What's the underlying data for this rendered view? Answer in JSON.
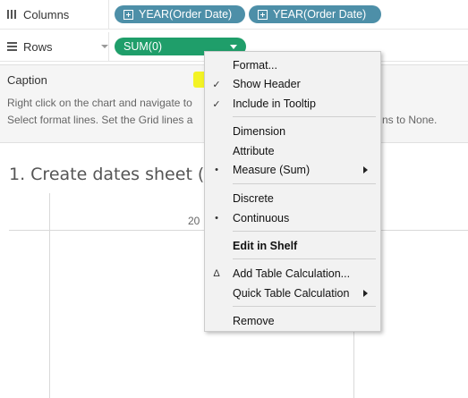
{
  "shelves": {
    "columns": {
      "label": "Columns",
      "pills": [
        "YEAR(Order Date)",
        "YEAR(Order Date)"
      ]
    },
    "rows": {
      "label": "Rows",
      "pill": "SUM(0)"
    }
  },
  "caption": {
    "title": "Caption",
    "line1": "Right click on the chart and navigate to",
    "line2": "Select format lines. Set the Grid lines a",
    "line2_tail": "ns to None."
  },
  "sheet": {
    "title": "1. Create dates sheet (2",
    "header_partial": "20"
  },
  "context_menu": {
    "items": [
      {
        "label": "Format...",
        "mark": "",
        "submenu": false
      },
      {
        "label": "Show Header",
        "mark": "✓",
        "submenu": false
      },
      {
        "label": "Include in Tooltip",
        "mark": "✓",
        "submenu": false
      },
      {
        "label": "Dimension",
        "mark": "",
        "submenu": false
      },
      {
        "label": "Attribute",
        "mark": "",
        "submenu": false
      },
      {
        "label": "Measure (Sum)",
        "mark": "•",
        "submenu": true
      },
      {
        "label": "Discrete",
        "mark": "",
        "submenu": false
      },
      {
        "label": "Continuous",
        "mark": "•",
        "submenu": false
      },
      {
        "label": "Edit in Shelf",
        "mark": "",
        "submenu": false
      },
      {
        "label": "Add Table Calculation...",
        "mark": "Δ",
        "submenu": false
      },
      {
        "label": "Quick Table Calculation",
        "mark": "",
        "submenu": true
      },
      {
        "label": "Remove",
        "mark": "",
        "submenu": false
      }
    ]
  },
  "colors": {
    "dimension_pill": "#4d8fa8",
    "measure_pill": "#1f9e6a",
    "highlight": "#f2f200"
  }
}
